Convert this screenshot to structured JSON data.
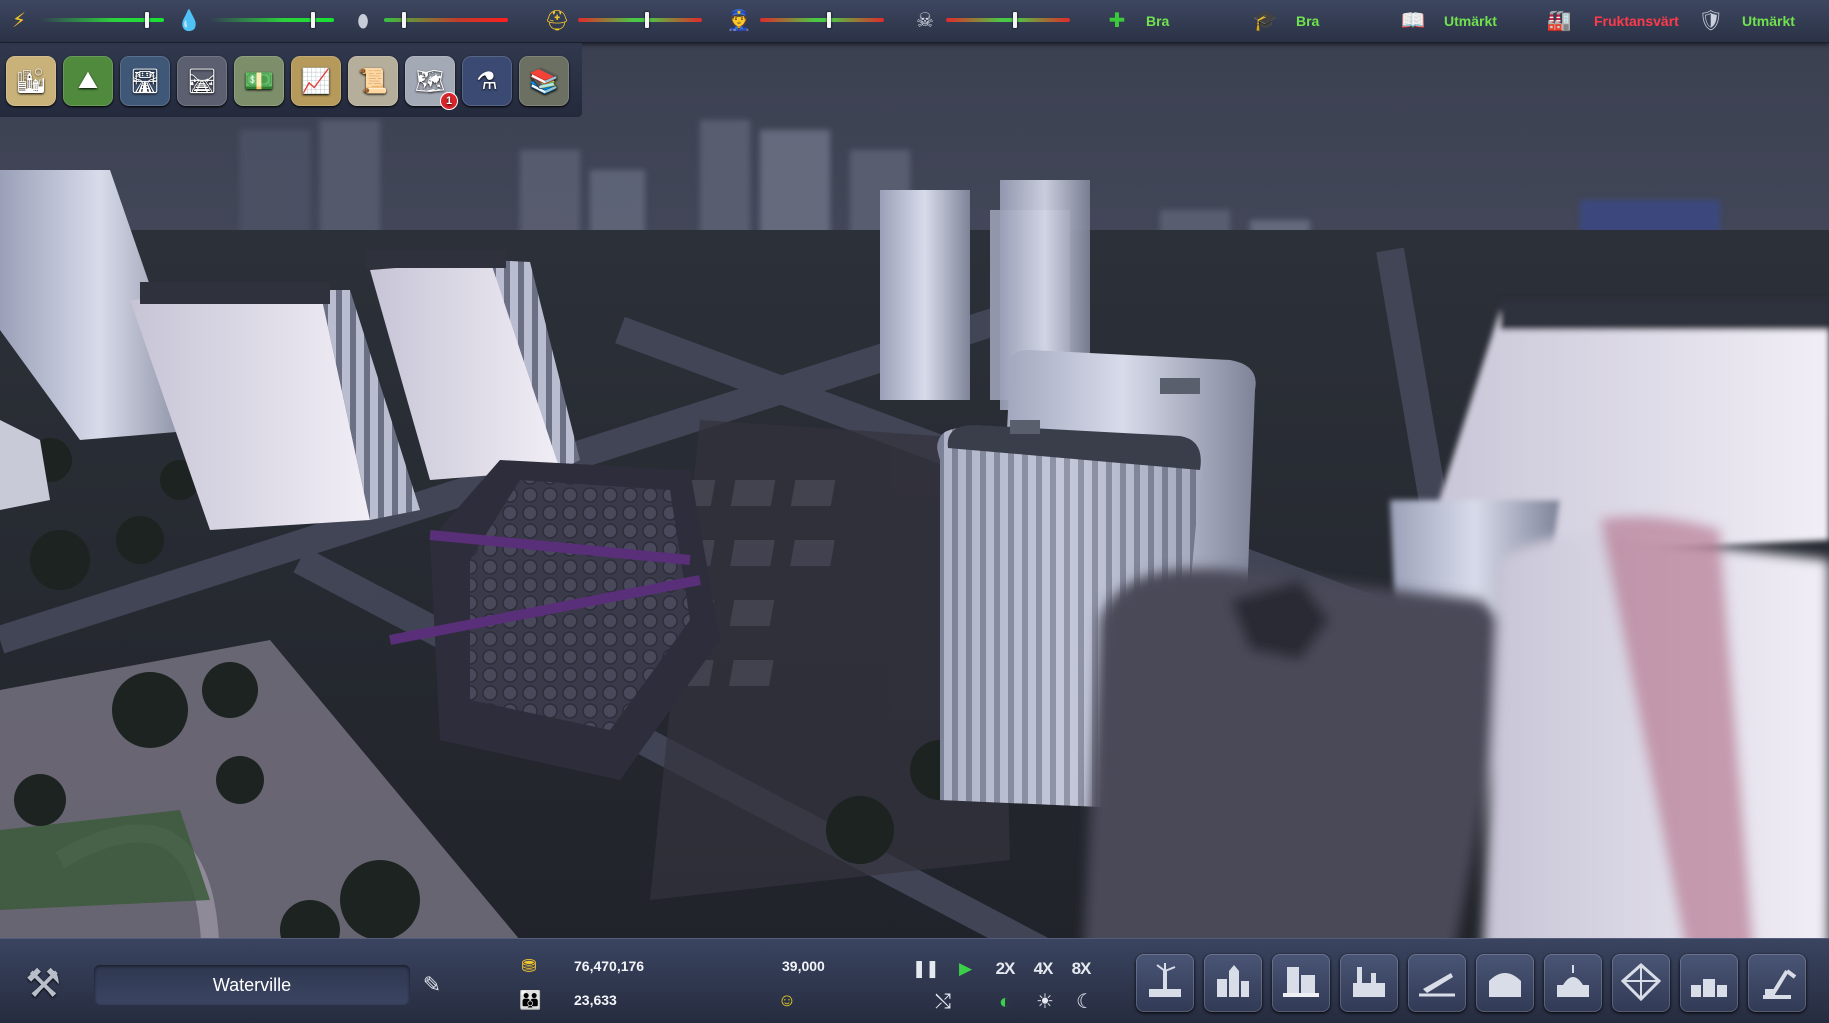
{
  "status_bar": {
    "meters": [
      {
        "id": "power",
        "icon": "lightning-icon",
        "glyph": "⚡",
        "color": "#f3c623",
        "level": 0.88
      },
      {
        "id": "water",
        "icon": "water-drop-icon",
        "glyph": "💧",
        "color": "#2aa5ff",
        "level": 0.85
      },
      {
        "id": "sewage",
        "icon": "waste-bag-icon",
        "glyph": "⬮",
        "color": "#c8ccd6",
        "level": 0.22
      },
      {
        "id": "fire",
        "icon": "firefighter-icon",
        "glyph": "⛑",
        "color": "#f0c32b",
        "level": 0.55
      },
      {
        "id": "police",
        "icon": "police-icon",
        "glyph": "👮",
        "color": "#4a7bd8",
        "level": 0.55
      },
      {
        "id": "crime",
        "icon": "crime-icon",
        "glyph": "☠",
        "color": "#d9dde6",
        "level": 0.55
      }
    ],
    "ratings": [
      {
        "id": "health",
        "icon": "health-cross-icon",
        "glyph": "✚",
        "label": "Bra",
        "status": "good"
      },
      {
        "id": "education",
        "icon": "education-icon",
        "glyph": "🎓",
        "label": "Bra",
        "status": "good"
      },
      {
        "id": "culture",
        "icon": "book-icon",
        "glyph": "📖",
        "label": "Utmärkt",
        "status": "good"
      },
      {
        "id": "pollution",
        "icon": "factory-pollution-icon",
        "glyph": "🏭",
        "label": "Fruktansvärt",
        "status": "bad"
      },
      {
        "id": "safety",
        "icon": "shield-icon",
        "glyph": "🛡",
        "label": "Utmärkt",
        "status": "good"
      }
    ]
  },
  "toolbox": {
    "tools": [
      {
        "name": "zoning-tool",
        "icon": "city-buildings-icon",
        "glyph": "🏙",
        "bg": "#c9b27a"
      },
      {
        "name": "landscape-tool",
        "icon": "terrain-icon",
        "glyph": "⛰",
        "bg": "#4f8a3d"
      },
      {
        "name": "road-tool",
        "icon": "road-icon",
        "glyph": "🛣",
        "bg": "#3f5878"
      },
      {
        "name": "rail-tool",
        "icon": "rail-icon",
        "glyph": "🛤",
        "bg": "#5b5f70"
      },
      {
        "name": "budget-tool",
        "icon": "money-icon",
        "glyph": "💵",
        "bg": "#7c8f6a"
      },
      {
        "name": "statistics-tool",
        "icon": "graph-icon",
        "glyph": "📈",
        "bg": "#b59a5b"
      },
      {
        "name": "policies-tool",
        "icon": "document-icon",
        "glyph": "📜",
        "bg": "#b5ae9a"
      },
      {
        "name": "info-views-tool",
        "icon": "info-map-icon",
        "glyph": "🗺",
        "bg": "#a4a9b6",
        "badge": "1"
      },
      {
        "name": "research-tool",
        "icon": "flask-icon",
        "glyph": "⚗",
        "bg": "#3a4a72"
      },
      {
        "name": "library-tool",
        "icon": "books-icon",
        "glyph": "📚",
        "bg": "#6b7062"
      }
    ]
  },
  "bottom_bar": {
    "city_name": "Waterville",
    "money": "76,470,176",
    "population": "23,633",
    "income": "39,000",
    "speed": {
      "pause": "❚❚",
      "play": "▶",
      "x2": "2X",
      "x4": "4X",
      "x8": "8X",
      "shuffle": "⤭",
      "daynight": "◐",
      "day": "☀",
      "night": "☾"
    },
    "build_menu": [
      {
        "name": "build-power-button",
        "icon": "power-plant-icon"
      },
      {
        "name": "build-residential-button",
        "icon": "residential-icon"
      },
      {
        "name": "build-commercial-button",
        "icon": "commercial-icon"
      },
      {
        "name": "build-industry-button",
        "icon": "industry-icon"
      },
      {
        "name": "build-transport-button",
        "icon": "airport-icon"
      },
      {
        "name": "build-services-button",
        "icon": "services-icon"
      },
      {
        "name": "build-government-button",
        "icon": "government-icon"
      },
      {
        "name": "build-landmark-button",
        "icon": "landmark-icon"
      },
      {
        "name": "build-decoration-button",
        "icon": "decoration-icon"
      },
      {
        "name": "build-bulldoze-button",
        "icon": "crane-icon"
      }
    ]
  }
}
